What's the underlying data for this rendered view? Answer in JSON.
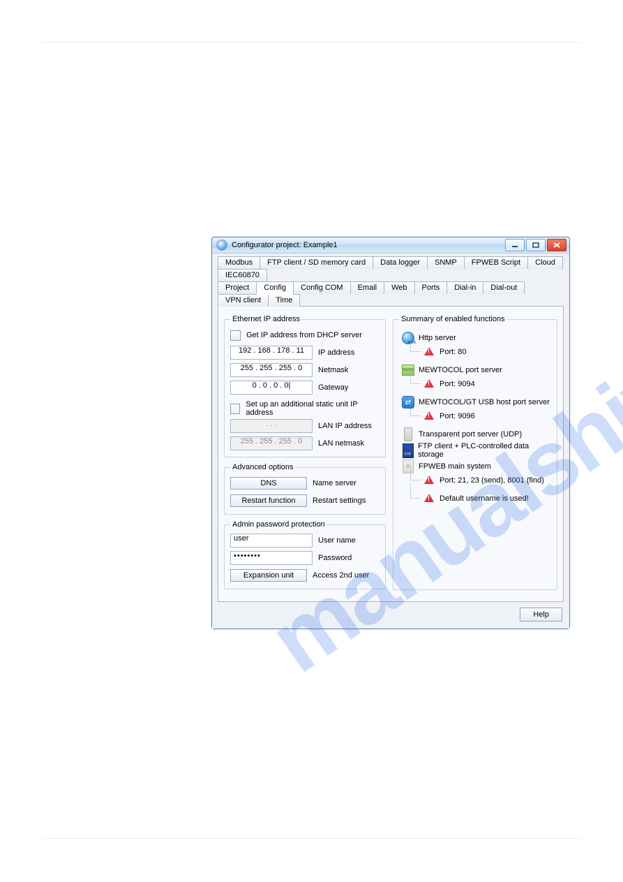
{
  "watermark": "manualshive.com",
  "window": {
    "title": "Configurator project: Example1"
  },
  "tabs_row1": [
    "Modbus",
    "FTP client / SD memory card",
    "Data logger",
    "SNMP",
    "FPWEB Script",
    "Cloud",
    "IEC60870"
  ],
  "tabs_row2": [
    "Project",
    "Config",
    "Config COM",
    "Email",
    "Web",
    "Ports",
    "Dial-in",
    "Dial-out",
    "VPN client",
    "Time"
  ],
  "active_tab": "Config",
  "ethernet": {
    "legend": "Ethernet IP address",
    "dhcp_label": "Get IP address from DHCP server",
    "ip": "192 . 168 . 178 .  11",
    "ip_label": "IP address",
    "netmask": "255 . 255 . 255 .   0",
    "netmask_label": "Netmask",
    "gateway": "0  .  0  .  0  .  0|",
    "gateway_label": "Gateway",
    "static_label": "Set up an additional static unit IP address",
    "lan_ip": " . . . ",
    "lan_ip_label": "LAN IP address",
    "lan_mask": "255 . 255 . 255 .   0",
    "lan_mask_label": "LAN netmask"
  },
  "advanced": {
    "legend": "Advanced options",
    "dns_btn": "DNS",
    "dns_label": "Name server",
    "restart_btn": "Restart function",
    "restart_label": "Restart settings"
  },
  "admin": {
    "legend": "Admin password protection",
    "user": "user",
    "user_label": "User name",
    "pwd": "••••••••",
    "pwd_label": "Password",
    "exp_btn": "Expansion unit",
    "exp_label": "Access 2nd user"
  },
  "summary": {
    "legend": "Summary of enabled functions",
    "items": [
      {
        "icon": "globe",
        "label": "Http server",
        "sub": [
          {
            "warn": true,
            "text": "Port: 80"
          }
        ]
      },
      {
        "icon": "rs232",
        "label": "MEWTOCOL port server",
        "sub": [
          {
            "warn": true,
            "text": "Port: 9094"
          }
        ]
      },
      {
        "icon": "usb",
        "label": "MEWTOCOL/GT USB host port server",
        "sub": [
          {
            "warn": true,
            "text": "Port: 9096"
          }
        ]
      },
      {
        "icon": "chip",
        "label": "Transparent port server (UDP)",
        "sub": []
      },
      {
        "icon": "sd",
        "label": "FTP client + PLC-controlled data storage",
        "sub": []
      },
      {
        "icon": "sys",
        "label": "FPWEB main system",
        "sub": [
          {
            "warn": true,
            "text": "Port: 21, 23 (send), 8001 (find)"
          },
          {
            "warn": true,
            "text": "Default username is used!"
          }
        ]
      }
    ]
  },
  "help_btn": "Help"
}
